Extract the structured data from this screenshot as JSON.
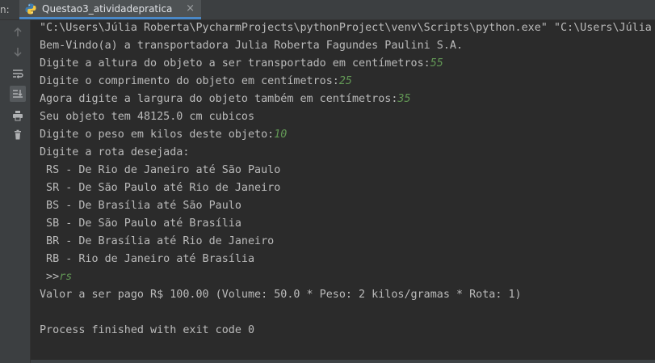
{
  "run_label": "n:",
  "tab": {
    "icon": "python-file-icon",
    "title": "Questao3_atividadepratica",
    "close": "×"
  },
  "sidebar": {
    "icons": [
      "arrow-up-icon",
      "arrow-down-icon",
      "soft-wrap-icon",
      "scroll-to-end-icon",
      "print-icon",
      "trash-icon"
    ]
  },
  "console": {
    "command": "\"C:\\Users\\Júlia Roberta\\PycharmProjects\\pythonProject\\venv\\Scripts\\python.exe\" \"C:\\Users\\Júlia R",
    "welcome": "Bem-Vindo(a) a transportadora Julia Roberta Fagundes Paulini S.A.",
    "prompt_height": "Digite a altura do objeto a ser transportado em centímetros:",
    "input_height": "55",
    "prompt_length": "Digite o comprimento do objeto em centímetros:",
    "input_length": "25",
    "prompt_width": "Agora digite a largura do objeto também em centímetros:",
    "input_width": "35",
    "volume_result": "Seu objeto tem 48125.0 cm cubicos",
    "prompt_weight": "Digite o peso em kilos deste objeto:",
    "input_weight": "10",
    "prompt_route": "Digite a rota desejada:",
    "routes": [
      " RS - De Rio de Janeiro até São Paulo",
      " SR - De São Paulo até Rio de Janeiro",
      " BS - De Brasília até São Paulo",
      " SB - De São Paulo até Brasília",
      " BR - De Brasília até Rio de Janeiro",
      " RB - Rio de Janeiro até Brasília"
    ],
    "route_prompt": " >>",
    "input_route": "rs",
    "price_result": "Valor a ser pago R$ 100.00 (Volume: 50.0 * Peso: 2 kilos/gramas * Rota: 1)",
    "blank": "",
    "exit": "Process finished with exit code 0"
  },
  "colors": {
    "background": "#2b2b2b",
    "text": "#bbbbbb",
    "user_input": "#629755",
    "tab_underline": "#4a88c7"
  }
}
